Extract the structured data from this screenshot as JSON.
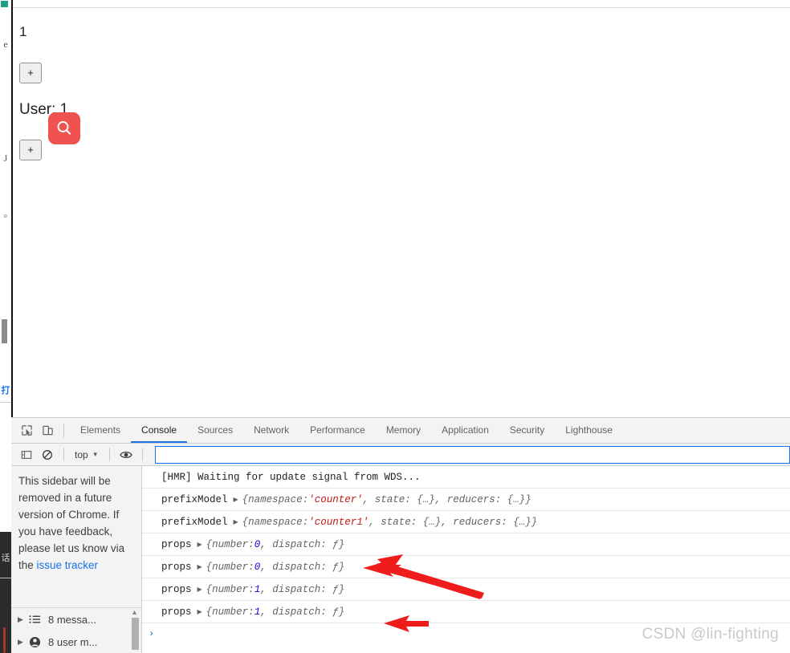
{
  "page": {
    "counter_value": "1",
    "increment_label_1": "+",
    "user_label": "User: 1",
    "increment_label_2": "+",
    "search_badge_icon": "search-icon",
    "search_badge_color": "#f0534f"
  },
  "devtools": {
    "inspect_icon": "inspect-element-icon",
    "device_toolbar_icon": "device-toolbar-icon",
    "tabs": [
      {
        "label": "Elements",
        "active": false
      },
      {
        "label": "Console",
        "active": true
      },
      {
        "label": "Sources",
        "active": false
      },
      {
        "label": "Network",
        "active": false
      },
      {
        "label": "Performance",
        "active": false
      },
      {
        "label": "Memory",
        "active": false
      },
      {
        "label": "Application",
        "active": false
      },
      {
        "label": "Security",
        "active": false
      },
      {
        "label": "Lighthouse",
        "active": false
      }
    ],
    "active_tab_underline_color": "#1a73e8",
    "toolbar": {
      "sidebar_toggle_icon": "console-sidebar-toggle-icon",
      "clear_console_icon": "clear-console-icon",
      "context_value": "top",
      "context_caret": "▼",
      "live_expression_icon": "eye-icon",
      "input_value": "",
      "input_placeholder": ""
    },
    "sidebar": {
      "notice_text_before_link": "This sidebar will be removed in a future version of Chrome. If you have feedback, please let us know via the ",
      "notice_link_text": "issue tracker",
      "rows": [
        {
          "arrow": "▶",
          "icon": "list-icon",
          "label": "8 messa..."
        },
        {
          "arrow": "▶",
          "icon": "user-icon",
          "label": "8 user m..."
        }
      ]
    },
    "console_rows": [
      {
        "kind": "plain",
        "text": "[HMR] Waiting for update signal from WDS..."
      },
      {
        "kind": "object",
        "name": "prefixModel",
        "triangle": "▶",
        "parts": [
          {
            "t": "obj",
            "v": "{namespace: "
          },
          {
            "t": "str",
            "v": "'counter'"
          },
          {
            "t": "obj",
            "v": ", state: {…}, reducers: {…}}"
          }
        ]
      },
      {
        "kind": "object",
        "name": "prefixModel",
        "triangle": "▶",
        "parts": [
          {
            "t": "obj",
            "v": "{namespace: "
          },
          {
            "t": "str",
            "v": "'counter1'"
          },
          {
            "t": "obj",
            "v": ", state: {…}, reducers: {…}}"
          }
        ]
      },
      {
        "kind": "object",
        "name": "props",
        "triangle": "▶",
        "parts": [
          {
            "t": "obj",
            "v": "{number: "
          },
          {
            "t": "num",
            "v": "0"
          },
          {
            "t": "obj",
            "v": ", dispatch: ƒ}"
          }
        ]
      },
      {
        "kind": "object",
        "name": "props",
        "triangle": "▶",
        "parts": [
          {
            "t": "obj",
            "v": "{number: "
          },
          {
            "t": "num",
            "v": "0"
          },
          {
            "t": "obj",
            "v": ", dispatch: ƒ}"
          }
        ]
      },
      {
        "kind": "object",
        "name": "props",
        "triangle": "▶",
        "parts": [
          {
            "t": "obj",
            "v": "{number: "
          },
          {
            "t": "num",
            "v": "1"
          },
          {
            "t": "obj",
            "v": ", dispatch: ƒ}"
          }
        ]
      },
      {
        "kind": "object",
        "name": "props",
        "triangle": "▶",
        "parts": [
          {
            "t": "obj",
            "v": "{number: "
          },
          {
            "t": "num",
            "v": "1"
          },
          {
            "t": "obj",
            "v": ", dispatch: ƒ}"
          }
        ]
      }
    ],
    "prompt_chevron": "›"
  },
  "annotations": {
    "arrow_color": "#ef1c1c",
    "arrow_count": 2
  },
  "watermark": "CSDN @lin-fighting"
}
